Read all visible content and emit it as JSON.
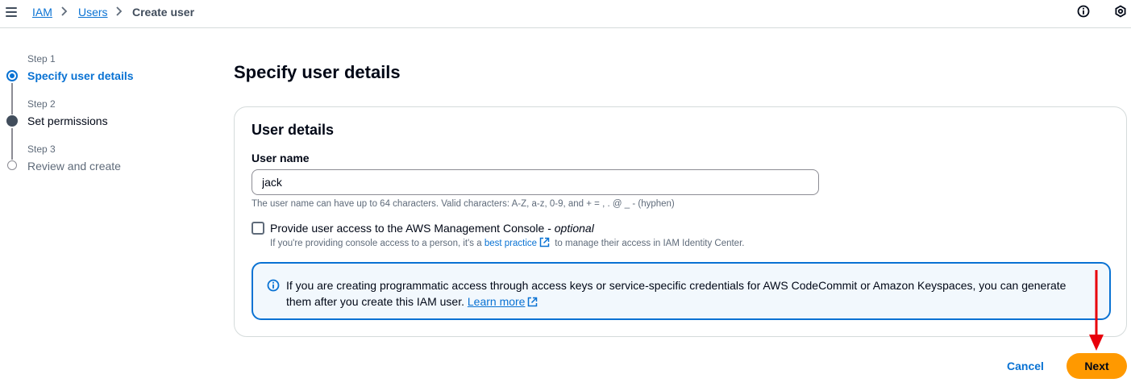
{
  "breadcrumb": {
    "items": [
      {
        "label": "IAM"
      },
      {
        "label": "Users"
      },
      {
        "label": "Create user"
      }
    ]
  },
  "steps": [
    {
      "label": "Step 1",
      "title": "Specify user details",
      "state": "current"
    },
    {
      "label": "Step 2",
      "title": "Set permissions",
      "state": "next"
    },
    {
      "label": "Step 3",
      "title": "Review and create",
      "state": "pending"
    }
  ],
  "page": {
    "title": "Specify user details"
  },
  "card": {
    "title": "User details",
    "username_label": "User name",
    "username_value": "jack",
    "username_hint": "The user name can have up to 64 characters. Valid characters: A-Z, a-z, 0-9, and + = , . @ _ - (hyphen)",
    "console_access_label": "Provide user access to the AWS Management Console - ",
    "console_access_optional": "optional",
    "console_access_checked": false,
    "console_desc_before": "If you're providing console access to a person, it's a ",
    "console_desc_link": "best practice",
    "console_desc_after": " to manage their access in IAM Identity Center."
  },
  "alert": {
    "text": "If you are creating programmatic access through access keys or service-specific credentials for AWS CodeCommit or Amazon Keyspaces, you can generate them after you create this IAM user. ",
    "link": "Learn more"
  },
  "actions": {
    "cancel": "Cancel",
    "next": "Next"
  },
  "colors": {
    "accent": "#0972d3",
    "primary_button": "#ff9900",
    "annotation_arrow": "#e8000b"
  },
  "icons": {
    "menu": "hamburger-icon",
    "info": "info-icon",
    "settings": "settings-icon",
    "external": "external-link-icon"
  }
}
